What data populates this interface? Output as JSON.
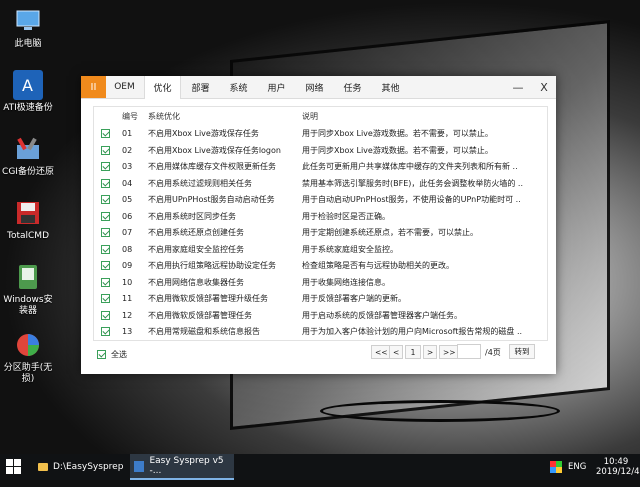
{
  "desktop": {
    "icons": [
      {
        "label": "此电脑",
        "icon": "computer-icon",
        "color": "#5aa7e8"
      },
      {
        "label": "ATI极速备份",
        "icon": "ati-backup-icon",
        "color": "#1e63b8"
      },
      {
        "label": "CGI备份还原",
        "icon": "cgi-restore-icon",
        "color": "#6aa0d8"
      },
      {
        "label": "TotalCMD",
        "icon": "floppy-icon",
        "color": "#c92a2a"
      },
      {
        "label": "Windows安装器",
        "icon": "windows-installer-icon",
        "color": "#4d9a4d"
      },
      {
        "label": "分区助手(无损)",
        "icon": "partition-icon",
        "color": "#e0453b"
      }
    ]
  },
  "window": {
    "tabs": {
      "ii": "II",
      "items": [
        "OEM",
        "优化",
        "部署",
        "系统",
        "用户",
        "网络",
        "任务",
        "其他"
      ],
      "active": "优化"
    },
    "controls": {
      "minimize": "—",
      "close": "X"
    },
    "table": {
      "headers": {
        "num": "编号",
        "option": "系统优化",
        "desc": "说明"
      },
      "rows": [
        {
          "num": "01",
          "option": "不启用Xbox Live游戏保存任务",
          "desc": "用于同步Xbox Live游戏数据。若不需要，可以禁止。"
        },
        {
          "num": "02",
          "option": "不启用Xbox Live游戏保存任务logon",
          "desc": "用于同步Xbox Live游戏数据。若不需要，可以禁止。"
        },
        {
          "num": "03",
          "option": "不启用媒体库缓存文件权限更新任务",
          "desc": "此任务可更新用户共享媒体库中缓存的文件夹列表和所有新 .."
        },
        {
          "num": "04",
          "option": "不启用系统过滤规则相关任务",
          "desc": "禁用基本筛选引擎服务时(BFE)，此任务会调整枚举防火墙的 .."
        },
        {
          "num": "05",
          "option": "不启用UPnPHost服务自动启动任务",
          "desc": "用于自动启动UPnPHost服务，不使用设备的UPnP功能时可 .."
        },
        {
          "num": "06",
          "option": "不启用系统时区同步任务",
          "desc": "用于检验时区是否正确。"
        },
        {
          "num": "07",
          "option": "不启用系统还原点创建任务",
          "desc": "用于定期创建系统还原点，若不需要，可以禁止。"
        },
        {
          "num": "08",
          "option": "不启用家庭组安全监控任务",
          "desc": "用于系统家庭组安全监控。"
        },
        {
          "num": "09",
          "option": "不启用执行组策略远程协助设定任务",
          "desc": "检查组策略是否有与远程协助相关的更改。"
        },
        {
          "num": "10",
          "option": "不启用网络信息收集器任务",
          "desc": "用于收集网络连接信息。"
        },
        {
          "num": "11",
          "option": "不启用微软反馈部署管理升级任务",
          "desc": "用于反馈部署客户端的更新。"
        },
        {
          "num": "12",
          "option": "不启用微软反馈部署管理任务",
          "desc": "用于启动系统的反馈部署管理器客户端任务。"
        },
        {
          "num": "13",
          "option": "不启用常规磁盘和系统信息报告",
          "desc": "用于为加入客户体验计划的用户向Microsoft报告常规的磁盘 .."
        }
      ]
    },
    "footer": {
      "select_all": "全选",
      "pager": {
        "first": "<<",
        "prev": "<",
        "page": "1",
        "next": ">",
        "last": ">>"
      },
      "page_input": "",
      "total": "/4页",
      "goto": "转到"
    }
  },
  "taskbar": {
    "items": [
      {
        "label": "D:\\EasySysprep",
        "icon": "folder-icon"
      },
      {
        "label": "Easy Sysprep v5 -...",
        "icon": "easysysprep-icon"
      }
    ],
    "tray": {
      "lang": "ENG",
      "time": "10:49",
      "date": "2019/12/4"
    },
    "colors": {
      "accent": "#f08a1c",
      "checkbox": "#3aa05a"
    }
  }
}
